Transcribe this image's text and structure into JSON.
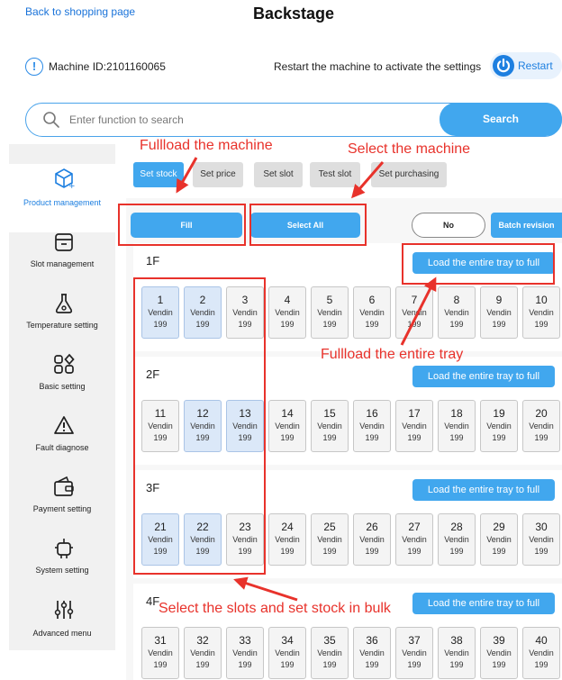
{
  "header": {
    "back_link": "Back to shopping page",
    "title": "Backstage"
  },
  "machine": {
    "info_icon": "!",
    "id_label": "Machine ID:2101160065",
    "restart_hint": "Restart the machine to activate the settings",
    "restart_label": "Restart"
  },
  "search": {
    "placeholder": "Enter function to search",
    "button": "Search"
  },
  "sidebar": {
    "items": [
      {
        "label": "Product management",
        "icon": "cube-icon"
      },
      {
        "label": "Slot management",
        "icon": "tray-icon"
      },
      {
        "label": "Temperature setting",
        "icon": "flask-icon"
      },
      {
        "label": "Basic setting",
        "icon": "shapes-icon"
      },
      {
        "label": "Fault diagnose",
        "icon": "warning-icon"
      },
      {
        "label": "Payment setting",
        "icon": "wallet-icon"
      },
      {
        "label": "System setting",
        "icon": "robot-icon"
      },
      {
        "label": "Advanced menu",
        "icon": "sliders-icon"
      }
    ]
  },
  "tabs": [
    "Set stock",
    "Set price",
    "Set slot",
    "Test slot",
    "Set purchasing"
  ],
  "actions": {
    "fill": "Fill",
    "select_all": "Select All",
    "no": "No",
    "batch_revision": "Batch revision"
  },
  "trays": [
    {
      "label": "1F",
      "load_button": "Load the entire tray to full",
      "slots": [
        {
          "num": "1",
          "name": "Vendin",
          "stock": "199"
        },
        {
          "num": "2",
          "name": "Vendin",
          "stock": "199"
        },
        {
          "num": "3",
          "name": "Vendin",
          "stock": "199"
        },
        {
          "num": "4",
          "name": "Vendin",
          "stock": "199"
        },
        {
          "num": "5",
          "name": "Vendin",
          "stock": "199"
        },
        {
          "num": "6",
          "name": "Vendin",
          "stock": "199"
        },
        {
          "num": "7",
          "name": "Vendin",
          "stock": "199"
        },
        {
          "num": "8",
          "name": "Vendin",
          "stock": "199"
        },
        {
          "num": "9",
          "name": "Vendin",
          "stock": "199"
        },
        {
          "num": "10",
          "name": "Vendin",
          "stock": "199"
        }
      ]
    },
    {
      "label": "2F",
      "load_button": "Load the entire tray to full",
      "slots": [
        {
          "num": "11",
          "name": "Vendin",
          "stock": "199"
        },
        {
          "num": "12",
          "name": "Vendin",
          "stock": "199"
        },
        {
          "num": "13",
          "name": "Vendin",
          "stock": "199"
        },
        {
          "num": "14",
          "name": "Vendin",
          "stock": "199"
        },
        {
          "num": "15",
          "name": "Vendin",
          "stock": "199"
        },
        {
          "num": "16",
          "name": "Vendin",
          "stock": "199"
        },
        {
          "num": "17",
          "name": "Vendin",
          "stock": "199"
        },
        {
          "num": "18",
          "name": "Vendin",
          "stock": "199"
        },
        {
          "num": "19",
          "name": "Vendin",
          "stock": "199"
        },
        {
          "num": "20",
          "name": "Vendin",
          "stock": "199"
        }
      ]
    },
    {
      "label": "3F",
      "load_button": "Load the entire tray to full",
      "slots": [
        {
          "num": "21",
          "name": "Vendin",
          "stock": "199"
        },
        {
          "num": "22",
          "name": "Vendin",
          "stock": "199"
        },
        {
          "num": "23",
          "name": "Vendin",
          "stock": "199"
        },
        {
          "num": "24",
          "name": "Vendin",
          "stock": "199"
        },
        {
          "num": "25",
          "name": "Vendin",
          "stock": "199"
        },
        {
          "num": "26",
          "name": "Vendin",
          "stock": "199"
        },
        {
          "num": "27",
          "name": "Vendin",
          "stock": "199"
        },
        {
          "num": "28",
          "name": "Vendin",
          "stock": "199"
        },
        {
          "num": "29",
          "name": "Vendin",
          "stock": "199"
        },
        {
          "num": "30",
          "name": "Vendin",
          "stock": "199"
        }
      ]
    },
    {
      "label": "4F",
      "load_button": "Load the entire tray to full",
      "slots": [
        {
          "num": "31",
          "name": "Vendin",
          "stock": "199"
        },
        {
          "num": "32",
          "name": "Vendin",
          "stock": "199"
        },
        {
          "num": "33",
          "name": "Vendin",
          "stock": "199"
        },
        {
          "num": "34",
          "name": "Vendin",
          "stock": "199"
        },
        {
          "num": "35",
          "name": "Vendin",
          "stock": "199"
        },
        {
          "num": "36",
          "name": "Vendin",
          "stock": "199"
        },
        {
          "num": "37",
          "name": "Vendin",
          "stock": "199"
        },
        {
          "num": "38",
          "name": "Vendin",
          "stock": "199"
        },
        {
          "num": "39",
          "name": "Vendin",
          "stock": "199"
        },
        {
          "num": "40",
          "name": "Vendin",
          "stock": "199"
        }
      ]
    }
  ],
  "annotations": {
    "fullload_machine": "Fullload the machine",
    "select_machine": "Select the machine",
    "fullload_tray": "Fullload the entire tray",
    "select_slots": "Select the slots and set stock in bulk"
  },
  "colors": {
    "accent": "#41a7ee",
    "selected_slot": "#dbe8f8",
    "annotation_red": "#e8322b"
  }
}
